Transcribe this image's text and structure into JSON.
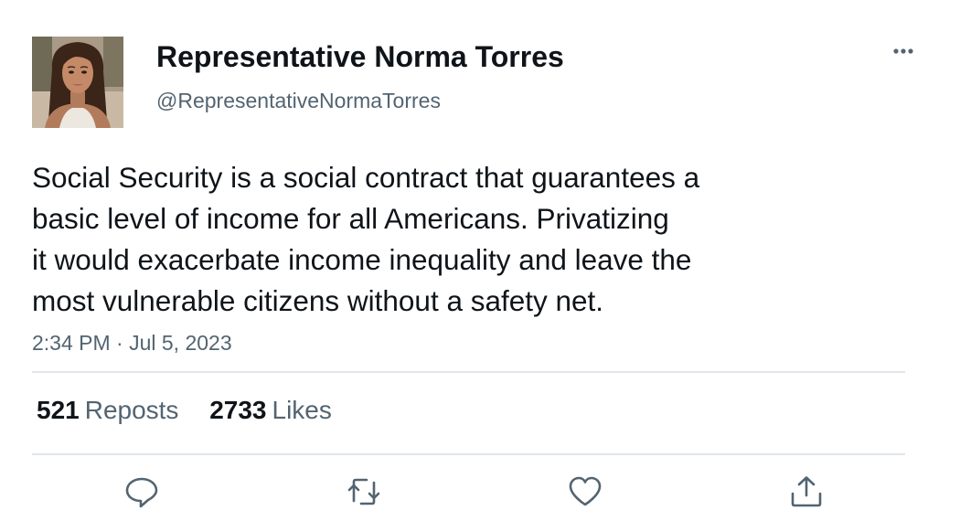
{
  "author": {
    "display_name": "Representative Norma Torres",
    "handle": "@RepresentativeNormaTorres",
    "avatar_icon": "profile-photo"
  },
  "tweet": {
    "text_lines": [
      "Social Security is a social contract that guarantees a",
      "basic level of income for all Americans. Privatizing",
      "it would exacerbate income inequality and leave the",
      "most vulnerable citizens without a safety net."
    ],
    "timestamp": "2:34 PM · Jul 5, 2023"
  },
  "stats": {
    "reposts_count": "521",
    "reposts_label": "Reposts",
    "likes_count": "2733",
    "likes_label": "Likes"
  },
  "actions": {
    "reply_icon": "reply-icon",
    "repost_icon": "repost-icon",
    "like_icon": "heart-icon",
    "share_icon": "share-icon",
    "more_icon": "more-options-icon"
  },
  "colors": {
    "text_primary": "#0f1419",
    "text_secondary": "#536471",
    "divider": "#e1e6ea",
    "icon": "#536471"
  }
}
